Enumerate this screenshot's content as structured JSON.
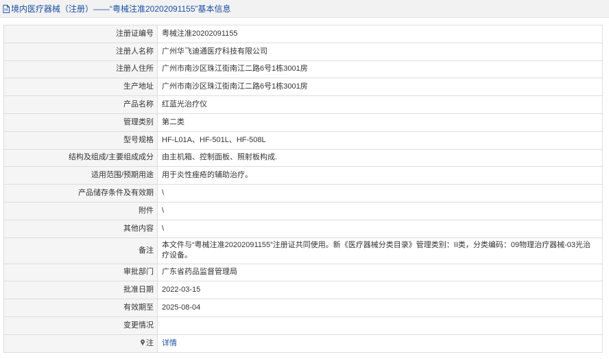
{
  "header": {
    "title": "境内医疗器械（注册）——“粤械注准20202091155”基本信息",
    "icon": "document-icon"
  },
  "rows": [
    {
      "label": "注册证编号",
      "value": "粤械注准20202091155"
    },
    {
      "label": "注册人名称",
      "value": "广州华飞迪通医疗科技有限公司"
    },
    {
      "label": "注册人住所",
      "value": "广州市南沙区珠江街南江二路6号1栋3001房"
    },
    {
      "label": "生产地址",
      "value": "广州市南沙区珠江街南江二路6号1栋3001房"
    },
    {
      "label": "产品名称",
      "value": "红蓝光治疗仪"
    },
    {
      "label": "管理类别",
      "value": "第二类"
    },
    {
      "label": "型号规格",
      "value": "HF-L01A、HF-501L、HF-508L"
    },
    {
      "label": "结构及组成/主要组成成分",
      "value": "由主机箱、控制面板、照射板构成."
    },
    {
      "label": "适用范围/预期用途",
      "value": "用于炎性痤疮的辅助治疗。"
    },
    {
      "label": "产品储存条件及有效期",
      "value": "\\"
    },
    {
      "label": "附件",
      "value": "\\"
    },
    {
      "label": "其他内容",
      "value": "\\"
    },
    {
      "label": "备注",
      "value": "本文件与“粤械注准20202091155”注册证共同使用。新《医疗器械分类目录》管理类别：II类，分类编码：09物理治疗器械-03光治疗设备。"
    },
    {
      "label": "审批部门",
      "value": "广东省药品监督管理局"
    },
    {
      "label": "批准日期",
      "value": "2022-03-15"
    },
    {
      "label": "有效期至",
      "value": "2025-08-04"
    },
    {
      "label": "变更情况",
      "value": ""
    },
    {
      "label": "注",
      "value": "详情",
      "icon": "pin-icon"
    }
  ],
  "colors": {
    "header_text": "#1a4fa0",
    "link": "#1a4fa0",
    "label_bg": "#f5f5f5",
    "border": "#dddddd"
  }
}
